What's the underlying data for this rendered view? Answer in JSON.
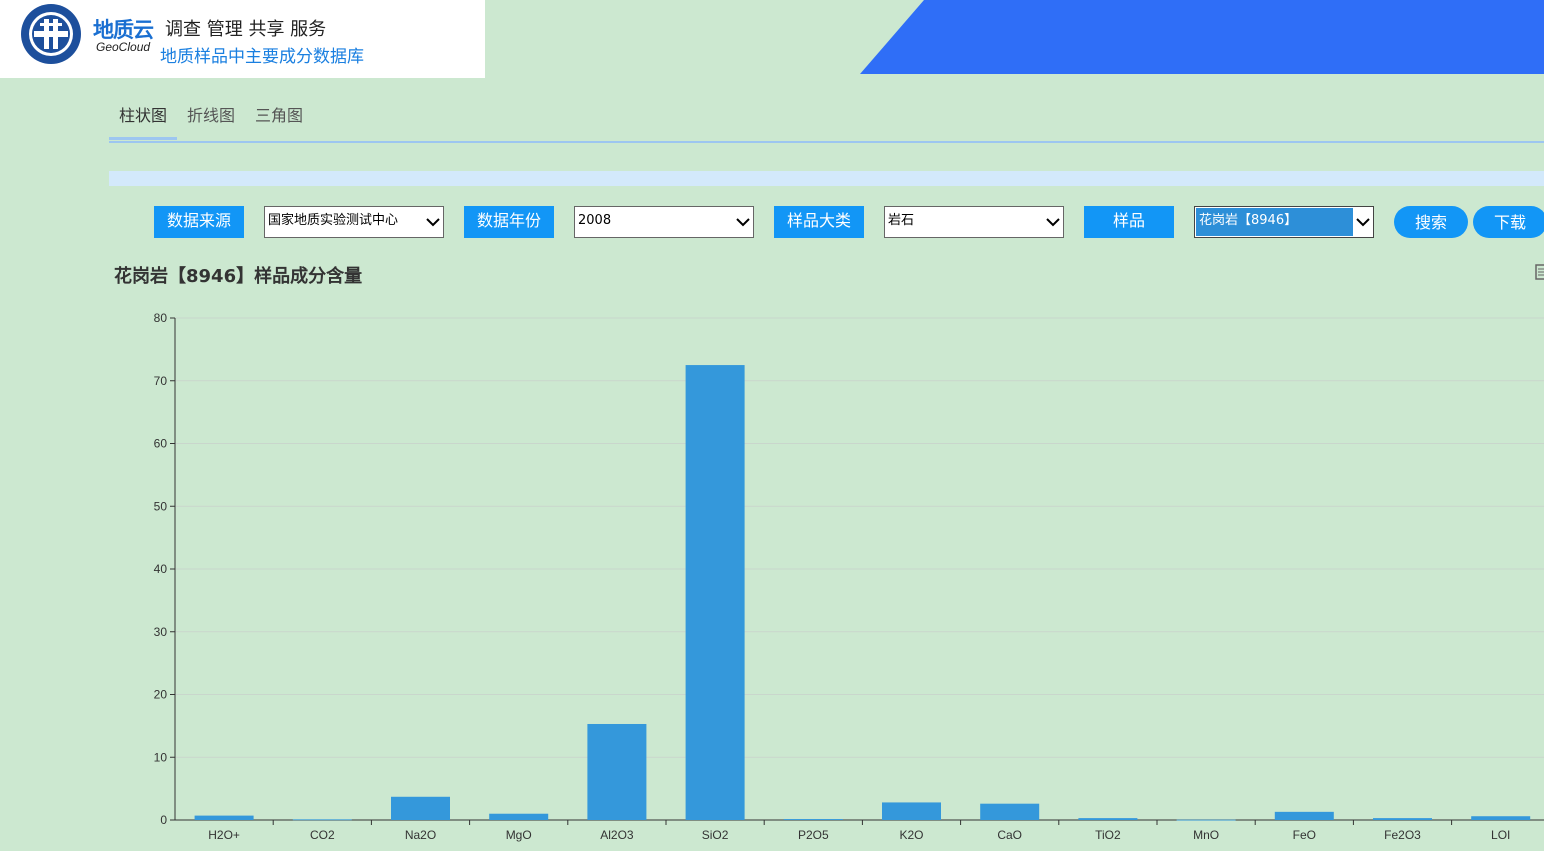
{
  "header": {
    "brand_cn": "地质云",
    "brand_en": "GeoCloud",
    "slogan": "调查 管理 共享 服务",
    "db_name": "地质样品中主要成分数据库",
    "colors": {
      "banner": "#2f6ef7",
      "brand": "#1a6fd1"
    }
  },
  "tabs": [
    {
      "label": "柱状图",
      "active": true
    },
    {
      "label": "折线图",
      "active": false
    },
    {
      "label": "三角图",
      "active": false
    }
  ],
  "filters": {
    "source_label": "数据来源",
    "source_value": "国家地质实验测试中心",
    "year_label": "数据年份",
    "year_value": "2008",
    "category_label": "样品大类",
    "category_value": "岩石",
    "sample_label": "样品",
    "sample_value": "花岗岩【8946】"
  },
  "buttons": {
    "search": "搜索",
    "download": "下载"
  },
  "chart_title": "花岗岩【8946】样品成分含量",
  "chart_data": {
    "type": "bar",
    "categories": [
      "H2O+",
      "CO2",
      "Na2O",
      "MgO",
      "Al2O3",
      "SiO2",
      "P2O5",
      "K2O",
      "CaO",
      "TiO2",
      "MnO",
      "FeO",
      "Fe2O3",
      "LOI"
    ],
    "values": [
      0.7,
      0.1,
      3.7,
      1.0,
      15.3,
      72.5,
      0.15,
      2.8,
      2.6,
      0.3,
      0.05,
      1.3,
      0.3,
      0.6
    ],
    "ylim": [
      0,
      80
    ],
    "yticks": [
      0,
      10,
      20,
      30,
      40,
      50,
      60,
      70,
      80
    ],
    "grid": true,
    "bar_color": "#3498db"
  }
}
